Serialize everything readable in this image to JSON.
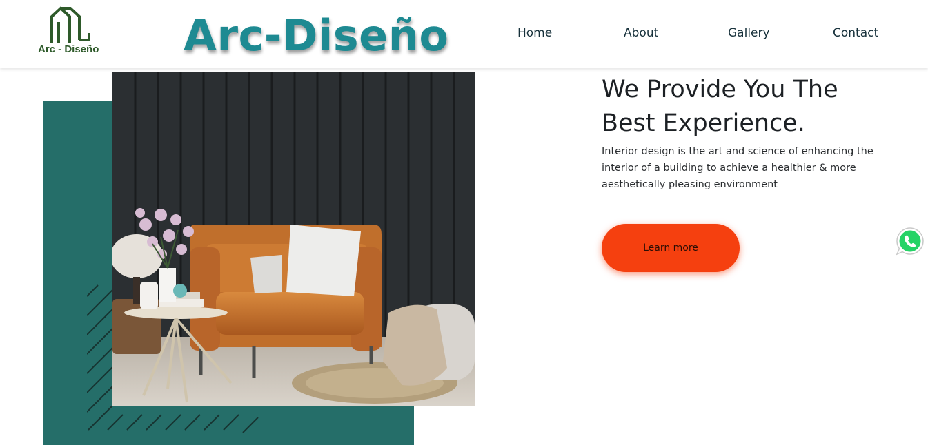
{
  "header": {
    "logo_text": "Arc - Diseño",
    "brand_title": "Arc-Diseño",
    "nav": [
      {
        "label": "Home"
      },
      {
        "label": "About"
      },
      {
        "label": "Gallery"
      },
      {
        "label": "Contact"
      }
    ]
  },
  "hero": {
    "title": "We Provide You The Best Experience.",
    "description": "Interior design is the art and science of enhancing the interior of a building to achieve a healthier & more aesthetically pleasing environment",
    "cta_label": "Learn more"
  },
  "icons": {
    "logo": "house-outline-icon",
    "floating": "whatsapp-icon"
  },
  "colors": {
    "brand_teal": "#1e8a92",
    "panel_teal": "#256e69",
    "cta_orange": "#f5400f",
    "logo_green": "#2e5a2a"
  }
}
